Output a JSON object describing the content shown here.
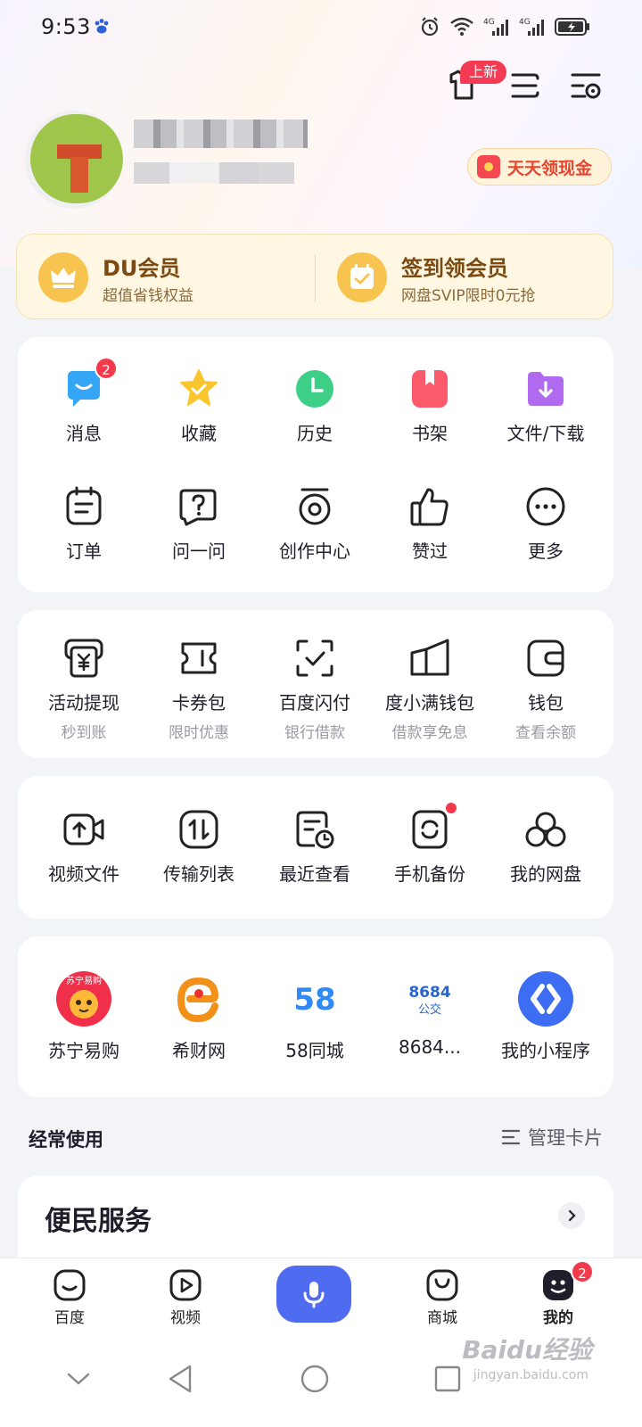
{
  "status_bar": {
    "time": "9:53",
    "network": "4G",
    "network2": "4G"
  },
  "header": {
    "new_badge": "上新",
    "icons": [
      "shirt-icon",
      "list-icon",
      "settings-icon"
    ]
  },
  "profile": {
    "cash_label": "天天领现金"
  },
  "member": {
    "left": {
      "title": "DU会员",
      "subtitle": "超值省钱权益"
    },
    "right": {
      "title": "签到领会员",
      "subtitle": "网盘SVIP限时0元抢"
    }
  },
  "quick_grid": [
    {
      "label": "消息",
      "icon": "message-icon",
      "badge": "2"
    },
    {
      "label": "收藏",
      "icon": "star-icon"
    },
    {
      "label": "历史",
      "icon": "clock-icon"
    },
    {
      "label": "书架",
      "icon": "bookshelf-icon"
    },
    {
      "label": "文件/下载",
      "icon": "download-folder-icon"
    },
    {
      "label": "订单",
      "icon": "order-icon"
    },
    {
      "label": "问一问",
      "icon": "question-icon"
    },
    {
      "label": "创作中心",
      "icon": "create-icon"
    },
    {
      "label": "赞过",
      "icon": "thumbs-up-icon"
    },
    {
      "label": "更多",
      "icon": "more-icon"
    }
  ],
  "finance": [
    {
      "label": "活动提现",
      "sub": "秒到账"
    },
    {
      "label": "卡券包",
      "sub": "限时优惠"
    },
    {
      "label": "百度闪付",
      "sub": "银行借款"
    },
    {
      "label": "度小满钱包",
      "sub": "借款享免息"
    },
    {
      "label": "钱包",
      "sub": "查看余额"
    }
  ],
  "netdisk": [
    {
      "label": "视频文件"
    },
    {
      "label": "传输列表"
    },
    {
      "label": "最近查看"
    },
    {
      "label": "手机备份"
    },
    {
      "label": "我的网盘"
    }
  ],
  "mini_apps": [
    {
      "label": "苏宁易购",
      "logo_text": "苏宁易购"
    },
    {
      "label": "希财网"
    },
    {
      "label": "58同城",
      "logo_text": "58"
    },
    {
      "label": "8684...",
      "logo_text": "8684",
      "logo_sub": "公交"
    },
    {
      "label": "我的小程序"
    }
  ],
  "frequent": {
    "title": "经常使用",
    "manage": "管理卡片"
  },
  "service": {
    "title": "便民服务"
  },
  "tabs": [
    {
      "label": "百度"
    },
    {
      "label": "视频"
    },
    {
      "label": "商城"
    },
    {
      "label": "我的",
      "badge": "2"
    }
  ],
  "watermark": {
    "text": "Baidu经验",
    "sub": "jingyan.baidu.com"
  },
  "colors": {
    "accent": "#4f6bf0",
    "badge": "#f23a4c",
    "gold": "#f8c450"
  }
}
